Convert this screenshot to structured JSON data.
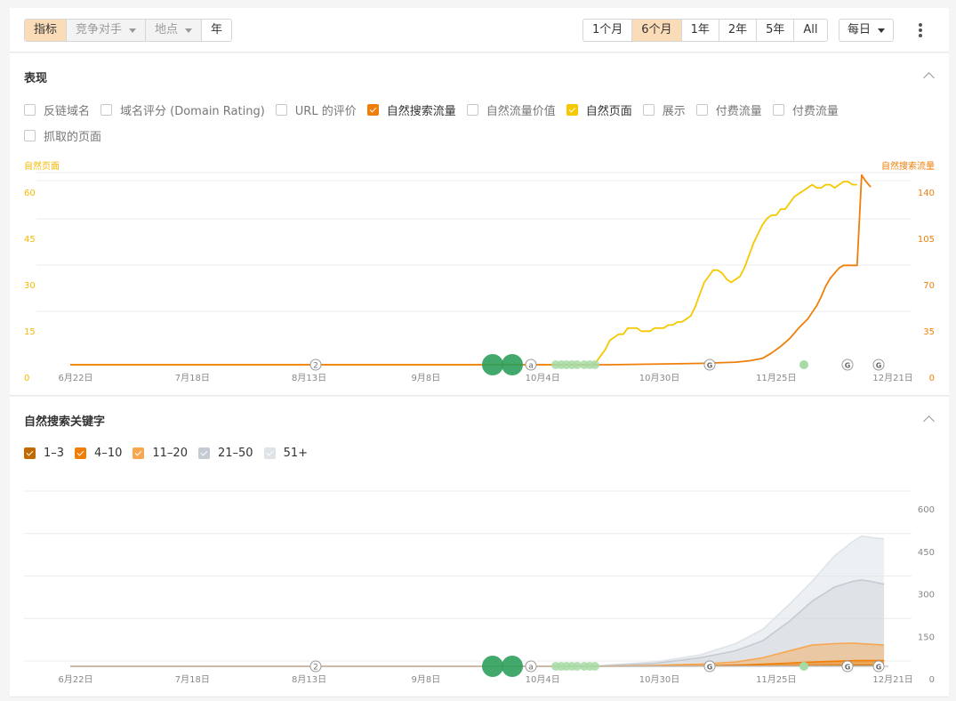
{
  "toolbar": {
    "metrics_tab": "指标",
    "competitors_dropdown": "竞争对手",
    "location_dropdown": "地点",
    "year_tab": "年",
    "ranges": [
      "1个月",
      "6个月",
      "1年",
      "2年",
      "5年",
      "All"
    ],
    "active_range": "6个月",
    "interval": "每日"
  },
  "performance": {
    "title": "表现",
    "checkboxes": [
      {
        "label": "反链域名",
        "checked": false,
        "color": ""
      },
      {
        "label": "域名评分 (Domain Rating)",
        "checked": false,
        "color": ""
      },
      {
        "label": "URL 的评价",
        "checked": false,
        "color": ""
      },
      {
        "label": "自然搜索流量",
        "checked": true,
        "color": "#f07f0a"
      },
      {
        "label": "自然流量价值",
        "checked": false,
        "color": ""
      },
      {
        "label": "自然页面",
        "checked": true,
        "color": "#f5c800"
      },
      {
        "label": "展示",
        "checked": false,
        "color": ""
      },
      {
        "label": "付费流量",
        "checked": false,
        "color": ""
      },
      {
        "label": "付费流量",
        "checked": false,
        "color": ""
      },
      {
        "label": "抓取的页面",
        "checked": false,
        "color": ""
      }
    ]
  },
  "keywords": {
    "title": "自然搜索关键字",
    "checkboxes": [
      {
        "label": "1–3",
        "checked": true,
        "color": "#c06a00"
      },
      {
        "label": "4–10",
        "checked": true,
        "color": "#f07f0a"
      },
      {
        "label": "11–20",
        "checked": true,
        "color": "#f7a750"
      },
      {
        "label": "21–50",
        "checked": true,
        "color": "#c5cbd3"
      },
      {
        "label": "51+",
        "checked": true,
        "color": "#dfe3e8"
      }
    ]
  },
  "chart_data": [
    {
      "type": "line",
      "title": "表现",
      "left_axis_label": "自然页面",
      "right_axis_label": "自然搜索流量",
      "x_tick_labels": [
        "6月22日",
        "7月18日",
        "8月13日",
        "9月8日",
        "10月4日",
        "10月30日",
        "11月25日",
        "12月21日"
      ],
      "left_ticks": [
        "0",
        "15",
        "30",
        "45",
        "60"
      ],
      "right_ticks": [
        "0",
        "35",
        "70",
        "105",
        "140"
      ],
      "left_ylim": [
        0,
        60
      ],
      "right_ylim": [
        0,
        140
      ],
      "x_range_days": [
        0,
        182
      ],
      "series": [
        {
          "name": "自然页面",
          "axis": "left",
          "color": "#f5c800",
          "points": [
            [
              0,
              0
            ],
            [
              116,
              0
            ],
            [
              117,
              1
            ],
            [
              118,
              3
            ],
            [
              119,
              5
            ],
            [
              120,
              8
            ],
            [
              121,
              9
            ],
            [
              122,
              10
            ],
            [
              123,
              10
            ],
            [
              124,
              12
            ],
            [
              125,
              12
            ],
            [
              126,
              12
            ],
            [
              127,
              11
            ],
            [
              128,
              11
            ],
            [
              129,
              11
            ],
            [
              130,
              12
            ],
            [
              131,
              12
            ],
            [
              132,
              12
            ],
            [
              133,
              13
            ],
            [
              134,
              13
            ],
            [
              135,
              14
            ],
            [
              136,
              14
            ],
            [
              137,
              15
            ],
            [
              138,
              16
            ],
            [
              139,
              19
            ],
            [
              140,
              23
            ],
            [
              141,
              27
            ],
            [
              142,
              29
            ],
            [
              143,
              31
            ],
            [
              144,
              31
            ],
            [
              145,
              30
            ],
            [
              146,
              28
            ],
            [
              147,
              27
            ],
            [
              148,
              28
            ],
            [
              149,
              29
            ],
            [
              150,
              32
            ],
            [
              151,
              36
            ],
            [
              152,
              40
            ],
            [
              153,
              43
            ],
            [
              154,
              46
            ],
            [
              155,
              48
            ],
            [
              156,
              49
            ],
            [
              157,
              49
            ],
            [
              158,
              51
            ],
            [
              159,
              51
            ],
            [
              160,
              53
            ],
            [
              161,
              55
            ],
            [
              162,
              56
            ],
            [
              163,
              57
            ],
            [
              164,
              58
            ],
            [
              165,
              59
            ],
            [
              166,
              58
            ],
            [
              167,
              58
            ],
            [
              168,
              59
            ],
            [
              169,
              59
            ],
            [
              170,
              58
            ],
            [
              171,
              59
            ],
            [
              172,
              60
            ],
            [
              173,
              60
            ],
            [
              174,
              59
            ],
            [
              175,
              59
            ]
          ]
        },
        {
          "name": "自然搜索流量",
          "axis": "right",
          "color": "#f07f0a",
          "points": [
            [
              0,
              0
            ],
            [
              120,
              0
            ],
            [
              140,
              1
            ],
            [
              148,
              2
            ],
            [
              151,
              3
            ],
            [
              154,
              5
            ],
            [
              156,
              9
            ],
            [
              158,
              14
            ],
            [
              160,
              20
            ],
            [
              162,
              28
            ],
            [
              164,
              35
            ],
            [
              165,
              40
            ],
            [
              166,
              45
            ],
            [
              167,
              52
            ],
            [
              168,
              60
            ],
            [
              169,
              66
            ],
            [
              170,
              70
            ],
            [
              171,
              74
            ],
            [
              172,
              76
            ],
            [
              173,
              76
            ],
            [
              174,
              76
            ],
            [
              175,
              76
            ],
            [
              176,
              145
            ],
            [
              177,
              140
            ],
            [
              178,
              136
            ]
          ]
        }
      ]
    },
    {
      "type": "area",
      "title": "自然搜索关键字",
      "x_tick_labels": [
        "6月22日",
        "7月18日",
        "8月13日",
        "9月8日",
        "10月4日",
        "10月30日",
        "11月25日",
        "12月21日"
      ],
      "right_ticks": [
        "0",
        "150",
        "300",
        "450",
        "600"
      ],
      "ylim": [
        0,
        600
      ],
      "x_range_days": [
        0,
        182
      ],
      "series": [
        {
          "name": "51+",
          "color": "#dfe3e8",
          "points": [
            [
              0,
              0
            ],
            [
              116,
              0
            ],
            [
              120,
              5
            ],
            [
              130,
              15
            ],
            [
              140,
              40
            ],
            [
              148,
              80
            ],
            [
              154,
              130
            ],
            [
              160,
              220
            ],
            [
              165,
              300
            ],
            [
              170,
              390
            ],
            [
              174,
              440
            ],
            [
              176,
              460
            ],
            [
              178,
              455
            ],
            [
              181,
              450
            ]
          ]
        },
        {
          "name": "21–50",
          "color": "#c5cbd3",
          "points": [
            [
              0,
              0
            ],
            [
              116,
              0
            ],
            [
              120,
              3
            ],
            [
              130,
              10
            ],
            [
              140,
              30
            ],
            [
              148,
              55
            ],
            [
              154,
              90
            ],
            [
              160,
              160
            ],
            [
              165,
              230
            ],
            [
              170,
              280
            ],
            [
              174,
              300
            ],
            [
              176,
              305
            ],
            [
              178,
              300
            ],
            [
              181,
              290
            ]
          ]
        },
        {
          "name": "11–20",
          "color": "#f7a750",
          "points": [
            [
              0,
              0
            ],
            [
              116,
              0
            ],
            [
              130,
              3
            ],
            [
              140,
              8
            ],
            [
              148,
              15
            ],
            [
              154,
              30
            ],
            [
              160,
              55
            ],
            [
              165,
              75
            ],
            [
              170,
              80
            ],
            [
              174,
              82
            ],
            [
              178,
              78
            ],
            [
              181,
              75
            ]
          ]
        },
        {
          "name": "4–10",
          "color": "#f07f0a",
          "points": [
            [
              0,
              0
            ],
            [
              116,
              0
            ],
            [
              140,
              2
            ],
            [
              150,
              5
            ],
            [
              158,
              10
            ],
            [
              165,
              15
            ],
            [
              170,
              18
            ],
            [
              175,
              20
            ],
            [
              181,
              20
            ]
          ]
        },
        {
          "name": "1–3",
          "color": "#c06a00",
          "points": [
            [
              0,
              0
            ],
            [
              116,
              0
            ],
            [
              150,
              1
            ],
            [
              165,
              2
            ],
            [
              175,
              3
            ],
            [
              181,
              3
            ]
          ]
        }
      ]
    }
  ],
  "annotations": {
    "count_marker": "2",
    "ahrefs_marker": "a",
    "google_marker": "G"
  }
}
